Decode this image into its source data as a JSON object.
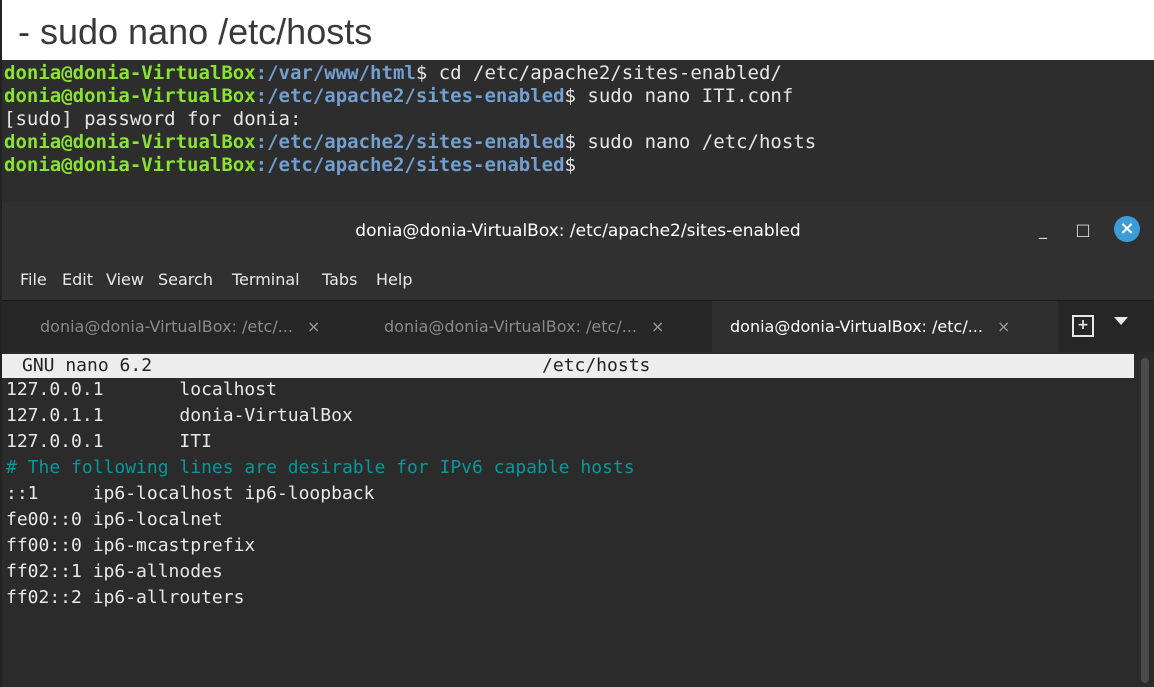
{
  "slide": {
    "title": "- sudo nano /etc/hosts"
  },
  "top_terminal": {
    "lines": [
      {
        "user": "donia@donia-VirtualBox",
        "path": ":/var/www/html",
        "cmd": "$ cd /etc/apache2/sites-enabled/"
      },
      {
        "user": "donia@donia-VirtualBox",
        "path": ":/etc/apache2/sites-enabled",
        "cmd": "$ sudo nano ITI.conf"
      },
      {
        "plain": "[sudo] password for donia:"
      },
      {
        "user": "donia@donia-VirtualBox",
        "path": ":/etc/apache2/sites-enabled",
        "cmd": "$ sudo nano /etc/hosts"
      },
      {
        "user": "donia@donia-VirtualBox",
        "path": ":/etc/apache2/sites-enabled",
        "cmd": "$"
      }
    ]
  },
  "window": {
    "title": "donia@donia-VirtualBox: /etc/apache2/sites-enabled",
    "minimize_glyph": "_",
    "maximize_glyph": "□",
    "close_glyph": "×",
    "close_color": "#3d9bd8",
    "menu": [
      "File",
      "Edit",
      "View",
      "Search",
      "Terminal",
      "Tabs",
      "Help"
    ],
    "tabs": [
      {
        "label": "donia@donia-VirtualBox: /etc/...",
        "close": "×",
        "active": false
      },
      {
        "label": "donia@donia-VirtualBox: /etc/...",
        "close": "×",
        "active": false
      },
      {
        "label": "donia@donia-VirtualBox: /etc/...",
        "close": "×",
        "active": true
      }
    ],
    "new_tab_glyph": "+"
  },
  "nano": {
    "version": "GNU nano 6.2",
    "filename": "/etc/hosts",
    "lines": [
      {
        "text": "127.0.0.1       localhost",
        "type": "normal"
      },
      {
        "text": "127.0.1.1       donia-VirtualBox",
        "type": "normal"
      },
      {
        "text": "127.0.0.1       ITI",
        "type": "normal"
      },
      {
        "text": "# The following lines are desirable for IPv6 capable hosts",
        "type": "comment"
      },
      {
        "text": "::1     ip6-localhost ip6-loopback",
        "type": "normal"
      },
      {
        "text": "fe00::0 ip6-localnet",
        "type": "normal"
      },
      {
        "text": "ff00::0 ip6-mcastprefix",
        "type": "normal"
      },
      {
        "text": "ff02::1 ip6-allnodes",
        "type": "normal"
      },
      {
        "text": "ff02::2 ip6-allrouters",
        "type": "normal"
      }
    ]
  },
  "colors": {
    "prompt_user": "#8ae234",
    "prompt_path": "#729fcf",
    "comment": "#06989a"
  }
}
